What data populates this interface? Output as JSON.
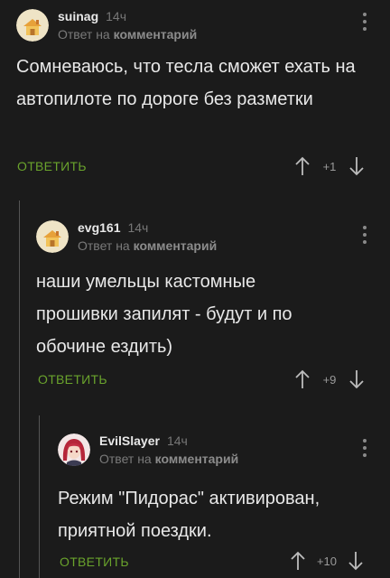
{
  "comments": [
    {
      "username": "suinag",
      "time": "14ч",
      "reply_to_prefix": "Ответ на",
      "reply_to_target": "комментарий",
      "text": "Сомневаюсь, что тесла сможет ехать на автопилоте по дороге без разметки",
      "reply_label": "ОТВЕТИТЬ",
      "score": "+1",
      "avatar_icon": "house-avatar-icon"
    },
    {
      "username": "evg161",
      "time": "14ч",
      "reply_to_prefix": "Ответ на",
      "reply_to_target": "комментарий",
      "text": "наши умельцы кастомные прошивки запилят - будут и по обочине ездить)",
      "reply_label": "ОТВЕТИТЬ",
      "score": "+9",
      "avatar_icon": "house-avatar-icon"
    },
    {
      "username": "EvilSlayer",
      "time": "14ч",
      "reply_to_prefix": "Ответ на",
      "reply_to_target": "комментарий",
      "text": "Режим \"Пидорас\" активирован, приятной поездки.",
      "reply_label": "ОТВЕТИТЬ",
      "score": "+10",
      "avatar_icon": "anime-girl-avatar-icon"
    }
  ],
  "colors": {
    "background": "#1b1b1b",
    "accent_green": "#6aa32c",
    "muted_text": "#7a7a7a",
    "body_text": "#e8e8e8"
  }
}
